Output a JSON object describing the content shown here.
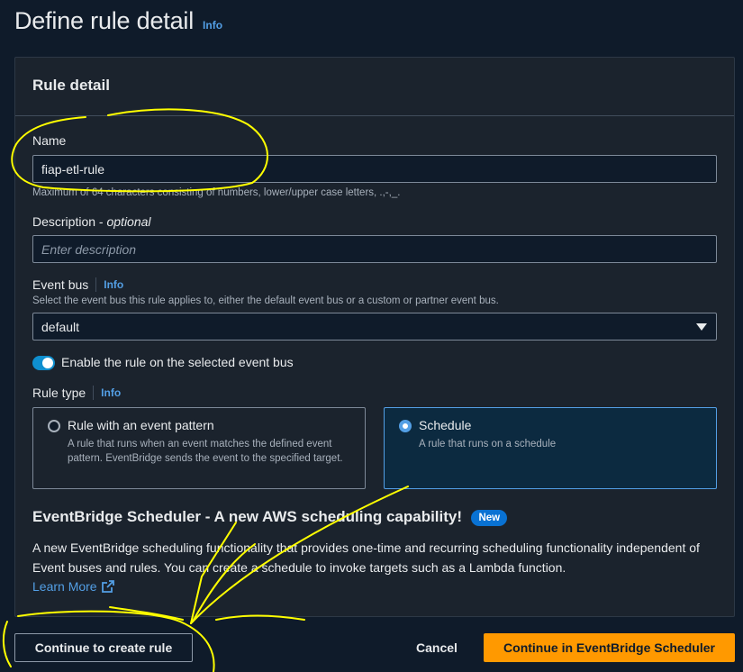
{
  "header": {
    "title": "Define rule detail",
    "info": "Info"
  },
  "panel": {
    "title": "Rule detail",
    "name": {
      "label": "Name",
      "value": "fiap-etl-rule",
      "hint": "Maximum of 64 characters consisting of numbers, lower/upper case letters, .,-,_."
    },
    "description": {
      "label": "Description",
      "optional": "optional",
      "placeholder": "Enter description"
    },
    "event_bus": {
      "label": "Event bus",
      "info": "Info",
      "hint": "Select the event bus this rule applies to, either the default event bus or a custom or partner event bus.",
      "value": "default"
    },
    "enable_toggle": {
      "label": "Enable the rule on the selected event bus",
      "on": true
    },
    "rule_type": {
      "label": "Rule type",
      "info": "Info",
      "options": [
        {
          "title": "Rule with an event pattern",
          "desc": "A rule that runs when an event matches the defined event pattern. EventBridge sends the event to the specified target.",
          "selected": false
        },
        {
          "title": "Schedule",
          "desc": "A rule that runs on a schedule",
          "selected": true
        }
      ]
    },
    "promo": {
      "title": "EventBridge Scheduler - A new AWS scheduling capability!",
      "badge": "New",
      "body": "A new EventBridge scheduling functionality that provides one-time and recurring scheduling functionality independent of Event buses and rules. You can create a schedule to invoke targets such as a Lambda function.",
      "learn_more": "Learn More"
    }
  },
  "footer": {
    "continue_rule": "Continue to create rule",
    "cancel": "Cancel",
    "continue_scheduler": "Continue in EventBridge Scheduler"
  },
  "colors": {
    "accent": "#539fe5",
    "primary_button": "#ff9900",
    "annotation": "#ffff00"
  }
}
